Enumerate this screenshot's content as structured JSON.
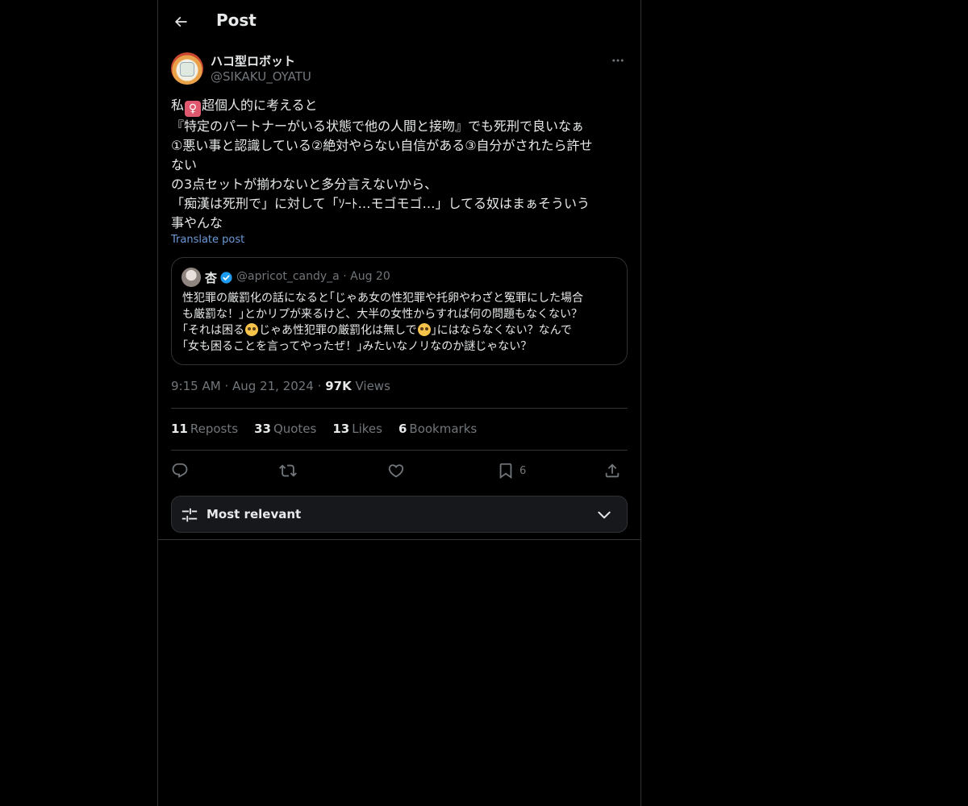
{
  "header": {
    "title": "Post",
    "back_icon": "arrow-left-icon"
  },
  "post": {
    "author": {
      "display_name": "ハコ型ロボット",
      "handle": "@SIKAKU_OYATU"
    },
    "body_lines": [
      {
        "before": "私",
        "emoji": "♀",
        "after": "超個人的に考えると"
      },
      "『特定のパートナーがいる状態で他の人間と接吻』でも死刑で良いなぁ",
      "①悪い事と認識している②絶対やらない自信がある③自分がされたら許せ",
      "ない",
      "の3点セットが揃わないと多分言えないから、",
      "「痴漢は死刑で」に対して「ｿｰﾄ…モゴモゴ…」してる奴はまぁそういう",
      "事やんな"
    ],
    "translate_label": "Translate post",
    "quote": {
      "name": "杏",
      "handle": "@apricot_candy_a",
      "separator": "·",
      "date": "Aug 20",
      "lines": [
        "性犯罪の厳罰化の話になると｢じゃあ女の性犯罪や托卵やわざと冤罪にした場合",
        "も厳罰な！｣とかリプが来るけど、大半の女性からすれば何の問題もなくない？",
        {
          "parts": [
            "｢それは困る",
            "じゃあ性犯罪の厳罰化は無しで",
            "｣にはならなくない？なんで"
          ]
        },
        "｢女も困ることを言ってやったぜ！｣みたいなノリなのか謎じゃない？"
      ]
    },
    "time": "9:15 AM",
    "date": "Aug 21, 2024",
    "separator": "·",
    "views_count": "97K",
    "views_label": "Views",
    "stats": [
      {
        "num": "11",
        "label": "Reposts"
      },
      {
        "num": "33",
        "label": "Quotes"
      },
      {
        "num": "13",
        "label": "Likes"
      },
      {
        "num": "6",
        "label": "Bookmarks"
      }
    ],
    "actions": {
      "reply_icon": "reply-icon",
      "repost_icon": "repost-icon",
      "like_icon": "heart-icon",
      "bookmark_icon": "bookmark-icon",
      "bookmark_count": "6",
      "share_icon": "share-icon"
    }
  },
  "sort": {
    "label": "Most relevant"
  },
  "colors": {
    "link": "#6a9bd8",
    "verified": "#1d9bf0",
    "muted": "#71767b",
    "border": "#2f3336"
  }
}
